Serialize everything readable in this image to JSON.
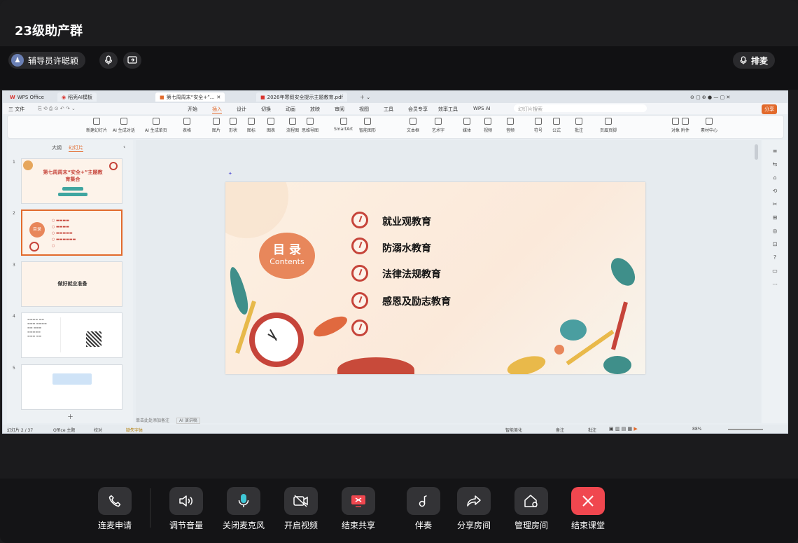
{
  "window": {
    "title": "23级助产群"
  },
  "top_bar": {
    "user_name": "辅导员许聪颖",
    "queue_button": "排麦"
  },
  "wps": {
    "tabs": [
      "WPS Office",
      "稻壳AI模板",
      "第七周周末“安全+”...",
      "2026年寒假安全提示主题教育.pdf"
    ],
    "search_placeholder": "幻灯片搜索",
    "share_label": "分享",
    "menu_file": "三 文件",
    "menu": [
      "开始",
      "插入",
      "设计",
      "切换",
      "动画",
      "放映",
      "审阅",
      "视图",
      "工具",
      "会员专享",
      "效率工具",
      "WPS AI"
    ],
    "ribbon": [
      "新建幻灯片",
      "AI 生成对话",
      "AI 生成单页",
      "表格",
      "图片",
      "形状",
      "图标",
      "图表",
      "流程图",
      "思维导图",
      "SmartArt",
      "智能图形",
      "文本框",
      "艺术字",
      "媒体",
      "视频",
      "音频",
      "符号",
      "公式",
      "批注",
      "页眉页脚",
      "对象",
      "附件",
      "素材中心"
    ],
    "pane_tabs": [
      "大纲",
      "幻灯片"
    ],
    "thumbs": [
      {
        "num": "1",
        "title": "第七周周末“安全+”主题教育集合"
      },
      {
        "num": "2",
        "title": "目录"
      },
      {
        "num": "3",
        "title": "做好就业准备"
      },
      {
        "num": "4",
        "title": ""
      },
      {
        "num": "5",
        "title": ""
      }
    ],
    "notes_placeholder": "单击此处添加备注",
    "ai_notes": "AI 演讲稿",
    "status_left": "幻灯片 2 / 37",
    "status_theme": "Office 主题",
    "status_proof": "校对",
    "status_font": "缺失字体",
    "status_zoom": "88%",
    "status_beautify": "智能美化",
    "status_notes": "备注",
    "status_comments": "批注"
  },
  "slide": {
    "heading": "目 录",
    "heading_en": "Contents",
    "items": [
      "就业观教育",
      "防溺水教育",
      "法律法规教育",
      "感恩及励志教育",
      ""
    ]
  },
  "controls": [
    {
      "label": "连麦申请",
      "icon": "phone-icon",
      "accent": false
    },
    {
      "label": "调节音量",
      "icon": "speaker-icon",
      "accent": false
    },
    {
      "label": "关闭麦克风",
      "icon": "mic-icon",
      "accent": false
    },
    {
      "label": "开启视频",
      "icon": "camera-off-icon",
      "accent": false
    },
    {
      "label": "结束共享",
      "icon": "screen-share-icon",
      "accent": false
    },
    {
      "label": "伴奏",
      "icon": "music-note-icon",
      "accent": false
    },
    {
      "label": "分享房间",
      "icon": "share-arrow-icon",
      "accent": false
    },
    {
      "label": "管理房间",
      "icon": "room-settings-icon",
      "accent": false
    },
    {
      "label": "结束课堂",
      "icon": "close-icon",
      "accent": true
    }
  ],
  "colors": {
    "accent_red": "#f0474f",
    "mic_teal": "#3fc7d6",
    "slide_red": "#c6443a",
    "wps_orange": "#e26a2c"
  }
}
